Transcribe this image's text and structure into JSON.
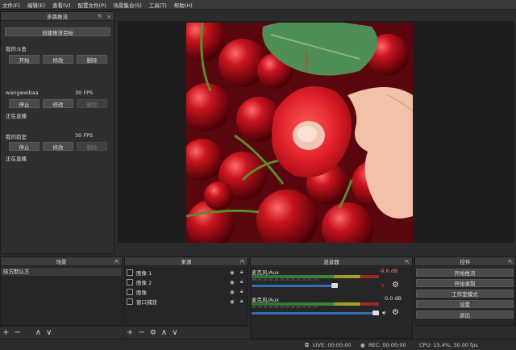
{
  "menu": [
    "文件(F)",
    "编辑(E)",
    "查看(V)",
    "配置文件(P)",
    "场景集合(S)",
    "工具(T)",
    "帮助(H)"
  ],
  "multistream": {
    "title": "多路推流",
    "add_button": "创建推流目标",
    "targets": [
      {
        "name": "我的斗鱼",
        "fps": "",
        "buttons": [
          "开始",
          "修改",
          "删除"
        ],
        "status": ""
      },
      {
        "name": "wangweibaa",
        "fps": "30 FPS",
        "buttons": [
          "停止",
          "修改",
          "删除"
        ],
        "status": "正在直播"
      },
      {
        "name": "我的前室",
        "fps": "30 FPS",
        "buttons": [
          "停止",
          "修改",
          "删除"
        ],
        "status": "正在直播"
      }
    ]
  },
  "scenes": {
    "title": "场景",
    "items": [
      "结方默认方"
    ]
  },
  "sources": {
    "title": "来源",
    "items": [
      "图像 1",
      "图像 2",
      "图像",
      "窗口捕获"
    ]
  },
  "mixer": {
    "title": "混音器",
    "channels": [
      {
        "name": "麦克风/Aux",
        "db": "-9.6 dB",
        "scale": "-60 -55 -50 -45 -40 -35 -30 -25 -20 -15 -10 -5 0",
        "level": 0.66,
        "volume": 0.68,
        "muted": true
      },
      {
        "name": "麦克风/Aux",
        "db": "0.0 dB",
        "scale": "-60 -55 -50 -45 -40 -35 -30 -25 -20 -15 -10 -5 0",
        "level": 0.55,
        "volume": 1.0,
        "muted": false
      }
    ]
  },
  "controls": {
    "title": "控件",
    "buttons": [
      "开始推流",
      "开始录制",
      "工作室模式",
      "设置",
      "退出"
    ]
  },
  "statusbar": {
    "live": "LIVE: 00:00:00",
    "rec": "REC: 00:00:00",
    "cpu": "CPU: 15.4%, 30.00 fps"
  },
  "colors": {
    "accent": "#2d6fb8",
    "muted": "#d02020"
  }
}
